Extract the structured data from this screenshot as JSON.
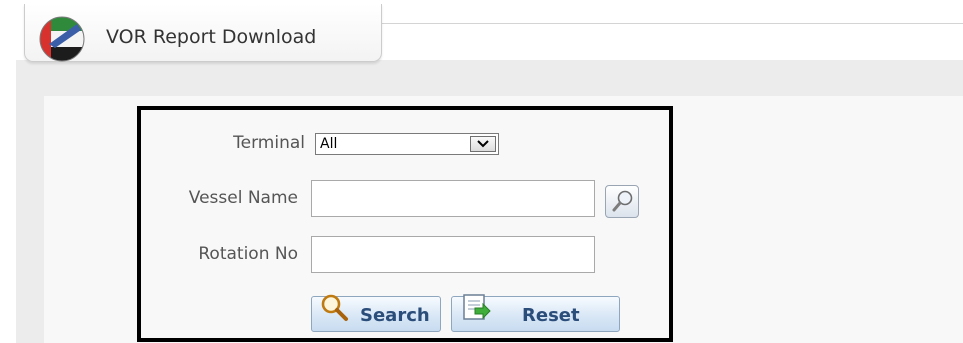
{
  "header": {
    "title": "VOR Report Download",
    "logo_icon": "company-logo-icon"
  },
  "form": {
    "terminal": {
      "label": "Terminal",
      "selected": "All",
      "icon": "chevron-down-icon"
    },
    "vessel_name": {
      "label": "Vessel Name",
      "value": "",
      "lookup_icon": "magnifier-icon"
    },
    "rotation_no": {
      "label": "Rotation No",
      "value": ""
    },
    "buttons": {
      "search_label": "Search",
      "search_icon": "search-icon",
      "reset_label": "Reset",
      "reset_icon": "reset-document-icon"
    }
  },
  "colors": {
    "button_text": "#2b4d7a",
    "label_text": "#555555",
    "frame_border": "#000000"
  }
}
